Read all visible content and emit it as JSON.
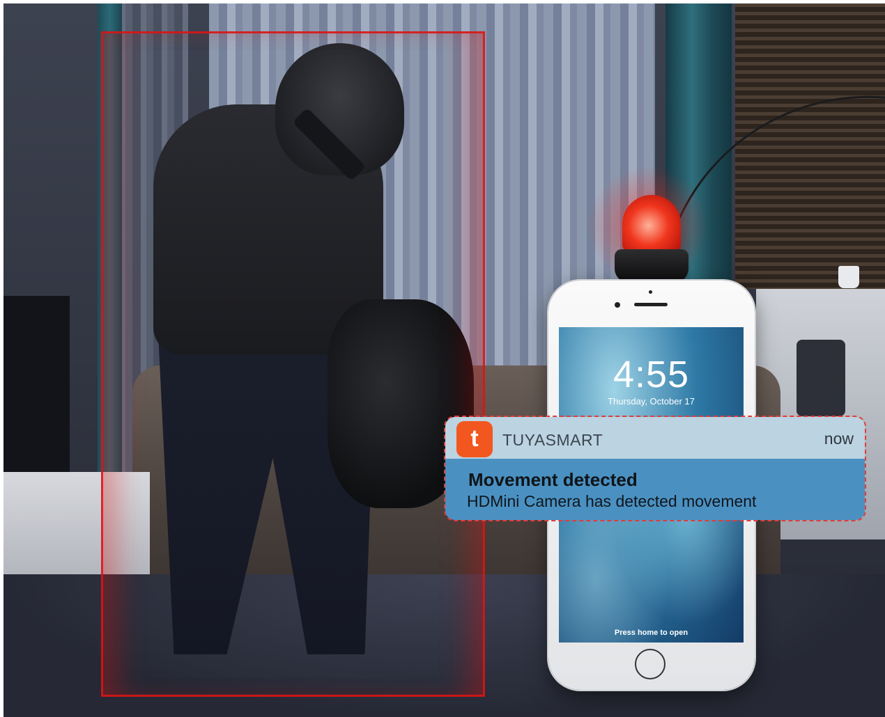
{
  "lock_screen": {
    "time": "4:55",
    "date": "Thursday, October 17",
    "hint": "Press home to open"
  },
  "notification": {
    "app_icon_glyph": "t",
    "app_name": "TUYASMART",
    "time": "now",
    "title": "Movement detected",
    "message": "HDMini Camera has detected movement"
  },
  "colors": {
    "detection_frame": "#dc1414",
    "app_icon": "#f2571f",
    "notification_body": "#4a91c2"
  }
}
